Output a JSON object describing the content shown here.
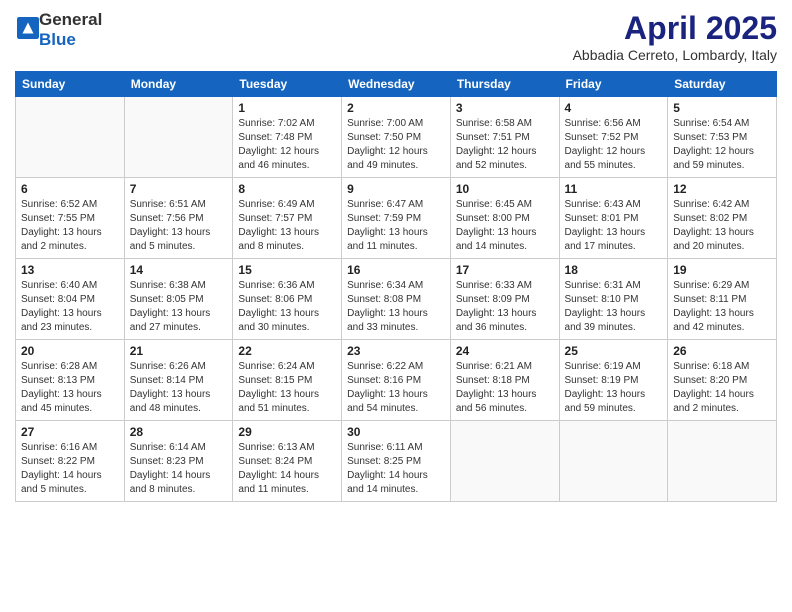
{
  "header": {
    "logo_general": "General",
    "logo_blue": "Blue",
    "month": "April 2025",
    "location": "Abbadia Cerreto, Lombardy, Italy"
  },
  "days_of_week": [
    "Sunday",
    "Monday",
    "Tuesday",
    "Wednesday",
    "Thursday",
    "Friday",
    "Saturday"
  ],
  "weeks": [
    [
      {
        "day": "",
        "info": ""
      },
      {
        "day": "",
        "info": ""
      },
      {
        "day": "1",
        "info": "Sunrise: 7:02 AM\nSunset: 7:48 PM\nDaylight: 12 hours and 46 minutes."
      },
      {
        "day": "2",
        "info": "Sunrise: 7:00 AM\nSunset: 7:50 PM\nDaylight: 12 hours and 49 minutes."
      },
      {
        "day": "3",
        "info": "Sunrise: 6:58 AM\nSunset: 7:51 PM\nDaylight: 12 hours and 52 minutes."
      },
      {
        "day": "4",
        "info": "Sunrise: 6:56 AM\nSunset: 7:52 PM\nDaylight: 12 hours and 55 minutes."
      },
      {
        "day": "5",
        "info": "Sunrise: 6:54 AM\nSunset: 7:53 PM\nDaylight: 12 hours and 59 minutes."
      }
    ],
    [
      {
        "day": "6",
        "info": "Sunrise: 6:52 AM\nSunset: 7:55 PM\nDaylight: 13 hours and 2 minutes."
      },
      {
        "day": "7",
        "info": "Sunrise: 6:51 AM\nSunset: 7:56 PM\nDaylight: 13 hours and 5 minutes."
      },
      {
        "day": "8",
        "info": "Sunrise: 6:49 AM\nSunset: 7:57 PM\nDaylight: 13 hours and 8 minutes."
      },
      {
        "day": "9",
        "info": "Sunrise: 6:47 AM\nSunset: 7:59 PM\nDaylight: 13 hours and 11 minutes."
      },
      {
        "day": "10",
        "info": "Sunrise: 6:45 AM\nSunset: 8:00 PM\nDaylight: 13 hours and 14 minutes."
      },
      {
        "day": "11",
        "info": "Sunrise: 6:43 AM\nSunset: 8:01 PM\nDaylight: 13 hours and 17 minutes."
      },
      {
        "day": "12",
        "info": "Sunrise: 6:42 AM\nSunset: 8:02 PM\nDaylight: 13 hours and 20 minutes."
      }
    ],
    [
      {
        "day": "13",
        "info": "Sunrise: 6:40 AM\nSunset: 8:04 PM\nDaylight: 13 hours and 23 minutes."
      },
      {
        "day": "14",
        "info": "Sunrise: 6:38 AM\nSunset: 8:05 PM\nDaylight: 13 hours and 27 minutes."
      },
      {
        "day": "15",
        "info": "Sunrise: 6:36 AM\nSunset: 8:06 PM\nDaylight: 13 hours and 30 minutes."
      },
      {
        "day": "16",
        "info": "Sunrise: 6:34 AM\nSunset: 8:08 PM\nDaylight: 13 hours and 33 minutes."
      },
      {
        "day": "17",
        "info": "Sunrise: 6:33 AM\nSunset: 8:09 PM\nDaylight: 13 hours and 36 minutes."
      },
      {
        "day": "18",
        "info": "Sunrise: 6:31 AM\nSunset: 8:10 PM\nDaylight: 13 hours and 39 minutes."
      },
      {
        "day": "19",
        "info": "Sunrise: 6:29 AM\nSunset: 8:11 PM\nDaylight: 13 hours and 42 minutes."
      }
    ],
    [
      {
        "day": "20",
        "info": "Sunrise: 6:28 AM\nSunset: 8:13 PM\nDaylight: 13 hours and 45 minutes."
      },
      {
        "day": "21",
        "info": "Sunrise: 6:26 AM\nSunset: 8:14 PM\nDaylight: 13 hours and 48 minutes."
      },
      {
        "day": "22",
        "info": "Sunrise: 6:24 AM\nSunset: 8:15 PM\nDaylight: 13 hours and 51 minutes."
      },
      {
        "day": "23",
        "info": "Sunrise: 6:22 AM\nSunset: 8:16 PM\nDaylight: 13 hours and 54 minutes."
      },
      {
        "day": "24",
        "info": "Sunrise: 6:21 AM\nSunset: 8:18 PM\nDaylight: 13 hours and 56 minutes."
      },
      {
        "day": "25",
        "info": "Sunrise: 6:19 AM\nSunset: 8:19 PM\nDaylight: 13 hours and 59 minutes."
      },
      {
        "day": "26",
        "info": "Sunrise: 6:18 AM\nSunset: 8:20 PM\nDaylight: 14 hours and 2 minutes."
      }
    ],
    [
      {
        "day": "27",
        "info": "Sunrise: 6:16 AM\nSunset: 8:22 PM\nDaylight: 14 hours and 5 minutes."
      },
      {
        "day": "28",
        "info": "Sunrise: 6:14 AM\nSunset: 8:23 PM\nDaylight: 14 hours and 8 minutes."
      },
      {
        "day": "29",
        "info": "Sunrise: 6:13 AM\nSunset: 8:24 PM\nDaylight: 14 hours and 11 minutes."
      },
      {
        "day": "30",
        "info": "Sunrise: 6:11 AM\nSunset: 8:25 PM\nDaylight: 14 hours and 14 minutes."
      },
      {
        "day": "",
        "info": ""
      },
      {
        "day": "",
        "info": ""
      },
      {
        "day": "",
        "info": ""
      }
    ]
  ]
}
